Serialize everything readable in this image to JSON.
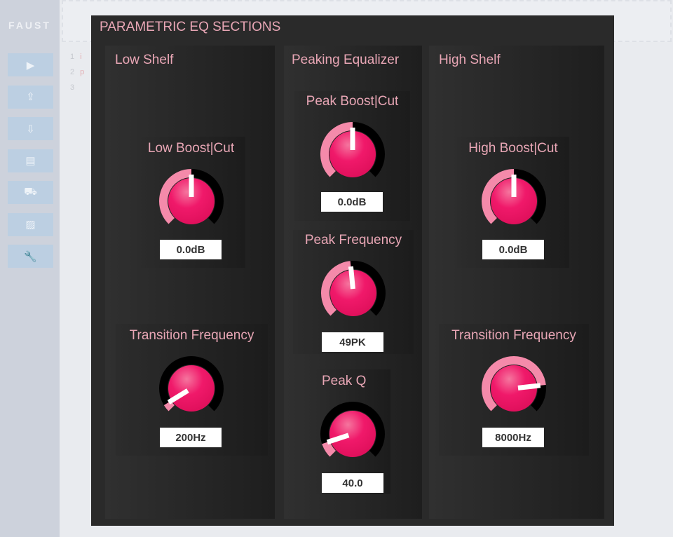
{
  "app": {
    "logo": "FAUST",
    "sidebar_icons": [
      "play-icon",
      "upload-icon",
      "download-icon",
      "docs-icon",
      "truck-icon",
      "image-icon",
      "wrench-icon"
    ],
    "sidebar_glyphs": [
      "▶",
      "⇪",
      "⇩",
      "▤",
      "⛟",
      "▨",
      "🔧"
    ]
  },
  "editor": {
    "lines": [
      {
        "n": "1",
        "t": "i"
      },
      {
        "n": "2",
        "t": "p"
      },
      {
        "n": "3",
        "t": ""
      }
    ]
  },
  "colors": {
    "accent": "#f0196a",
    "arc_fill": "#f48aaa",
    "label": "#e8a6b5"
  },
  "panel": {
    "title": "PARAMETRIC EQ SECTIONS",
    "low_shelf": {
      "title": "Low Shelf",
      "boost": {
        "label": "Low Boost|Cut",
        "value": "0.0dB",
        "level": 0.5
      },
      "freq": {
        "label": "Transition Frequency",
        "value": "200Hz",
        "level": 0.05
      }
    },
    "peaking": {
      "title": "Peaking Equalizer",
      "boost": {
        "label": "Peak Boost|Cut",
        "value": "0.0dB",
        "level": 0.5
      },
      "freq": {
        "label": "Peak Frequency",
        "value": "49PK",
        "level": 0.48
      },
      "q": {
        "label": "Peak Q",
        "value": "40.0",
        "level": 0.1
      }
    },
    "high_shelf": {
      "title": "High Shelf",
      "boost": {
        "label": "High Boost|Cut",
        "value": "0.0dB",
        "level": 0.5
      },
      "freq": {
        "label": "Transition Frequency",
        "value": "8000Hz",
        "level": 0.81
      }
    }
  }
}
